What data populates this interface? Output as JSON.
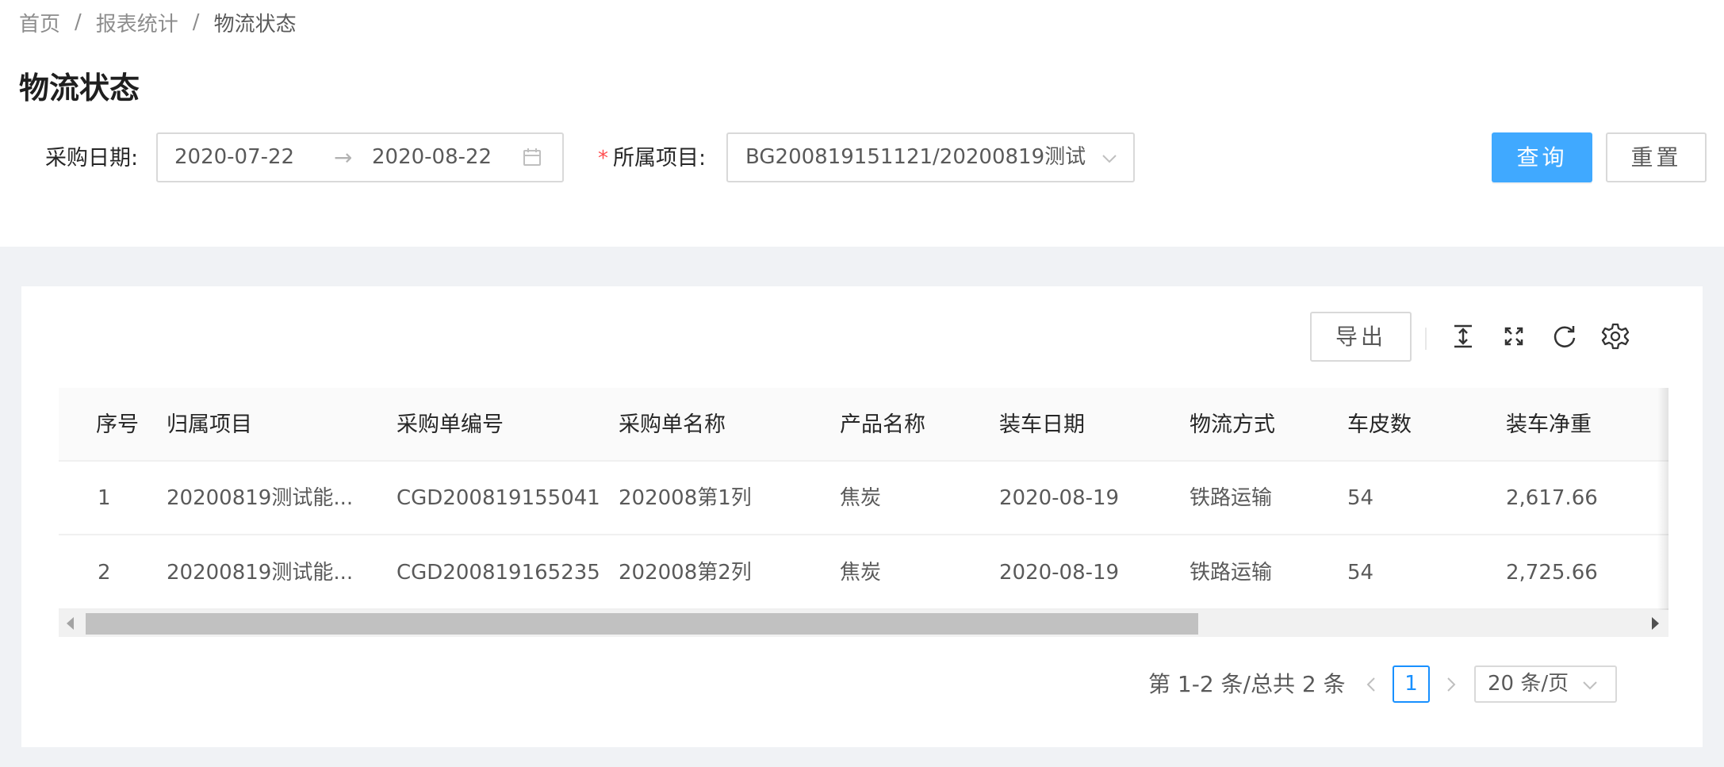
{
  "breadcrumb": {
    "home": "首页",
    "sep1": "/",
    "section": "报表统计",
    "sep2": "/",
    "current": "物流状态"
  },
  "page_title": "物流状态",
  "filters": {
    "date_label": "采购日期:",
    "date_start": "2020-07-22",
    "date_arrow": "→",
    "date_end": "2020-08-22",
    "project_required": "*",
    "project_label": "所属项目:",
    "project_value": "BG200819151121/20200819测试..."
  },
  "actions": {
    "query": "查询",
    "reset": "重置",
    "export": "导出"
  },
  "toolbar_icons": [
    "column-height-icon",
    "fullscreen-icon",
    "reload-icon",
    "setting-icon"
  ],
  "table": {
    "columns": [
      "序号",
      "归属项目",
      "采购单编号",
      "采购单名称",
      "产品名称",
      "装车日期",
      "物流方式",
      "车皮数",
      "装车净重"
    ],
    "rows": [
      [
        "1",
        "20200819测试能...",
        "CGD200819155041",
        "202008第1列",
        "焦炭",
        "2020-08-19",
        "铁路运输",
        "54",
        "2,617.66"
      ],
      [
        "2",
        "20200819测试能...",
        "CGD200819165235",
        "202008第2列",
        "焦炭",
        "2020-08-19",
        "铁路运输",
        "54",
        "2,725.66"
      ]
    ]
  },
  "pagination": {
    "total": "第 1-2 条/总共 2 条",
    "current_page": "1",
    "page_size": "20 条/页"
  },
  "colors": {
    "primary": "#40a9ff",
    "active_page": "#1890ff",
    "required": "#ff4d4f"
  }
}
